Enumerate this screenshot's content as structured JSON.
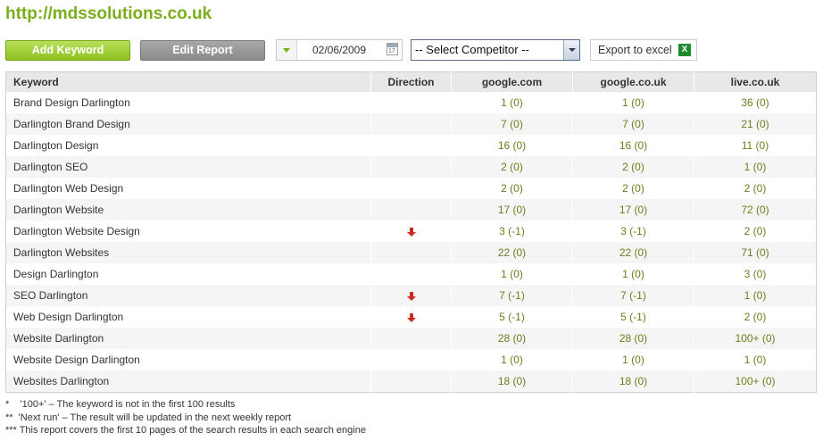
{
  "site": {
    "title": "http://mdssolutions.co.uk"
  },
  "toolbar": {
    "add_keyword_label": "Add Keyword",
    "edit_report_label": "Edit Report",
    "date_value": "02/06/2009",
    "competitor_selected": "-- Select Competitor --",
    "export_label": "Export to excel",
    "calendar_icon": "calendar-icon",
    "excel_icon": "excel-icon"
  },
  "colors": {
    "brand_green": "#7aae1a",
    "value_olive": "#6b7e1e",
    "arrow_red": "#cc2b20"
  },
  "table": {
    "headers": [
      "Keyword",
      "Direction",
      "google.com",
      "google.co.uk",
      "live.co.uk"
    ],
    "rows": [
      {
        "keyword": "Brand Design Darlington",
        "direction": "",
        "google_com": "1 (0)",
        "google_co_uk": "1 (0)",
        "live_co_uk": "36 (0)"
      },
      {
        "keyword": "Darlington Brand Design",
        "direction": "",
        "google_com": "7 (0)",
        "google_co_uk": "7 (0)",
        "live_co_uk": "21 (0)"
      },
      {
        "keyword": "Darlington Design",
        "direction": "",
        "google_com": "16 (0)",
        "google_co_uk": "16 (0)",
        "live_co_uk": "11 (0)"
      },
      {
        "keyword": "Darlington SEO",
        "direction": "",
        "google_com": "2 (0)",
        "google_co_uk": "2 (0)",
        "live_co_uk": "1 (0)"
      },
      {
        "keyword": "Darlington Web Design",
        "direction": "",
        "google_com": "2 (0)",
        "google_co_uk": "2 (0)",
        "live_co_uk": "2 (0)"
      },
      {
        "keyword": "Darlington Website",
        "direction": "",
        "google_com": "17 (0)",
        "google_co_uk": "17 (0)",
        "live_co_uk": "72 (0)"
      },
      {
        "keyword": "Darlington Website Design",
        "direction": "down",
        "google_com": "3 (-1)",
        "google_co_uk": "3 (-1)",
        "live_co_uk": "2 (0)"
      },
      {
        "keyword": "Darlington Websites",
        "direction": "",
        "google_com": "22 (0)",
        "google_co_uk": "22 (0)",
        "live_co_uk": "71 (0)"
      },
      {
        "keyword": "Design Darlington",
        "direction": "",
        "google_com": "1 (0)",
        "google_co_uk": "1 (0)",
        "live_co_uk": "3 (0)"
      },
      {
        "keyword": "SEO Darlington",
        "direction": "down",
        "google_com": "7 (-1)",
        "google_co_uk": "7 (-1)",
        "live_co_uk": "1 (0)"
      },
      {
        "keyword": "Web Design Darlington",
        "direction": "down",
        "google_com": "5 (-1)",
        "google_co_uk": "5 (-1)",
        "live_co_uk": "2 (0)"
      },
      {
        "keyword": "Website Darlington",
        "direction": "",
        "google_com": "28 (0)",
        "google_co_uk": "28 (0)",
        "live_co_uk": "100+ (0)"
      },
      {
        "keyword": "Website Design Darlington",
        "direction": "",
        "google_com": "1 (0)",
        "google_co_uk": "1 (0)",
        "live_co_uk": "1 (0)"
      },
      {
        "keyword": "Websites Darlington",
        "direction": "",
        "google_com": "18 (0)",
        "google_co_uk": "18 (0)",
        "live_co_uk": "100+ (0)"
      }
    ]
  },
  "notes": [
    "*    '100+' – The keyword is not in the first 100 results",
    "**  'Next run' – The result will be updated in the next weekly report",
    "*** This report covers the first 10 pages of the search results in each search engine"
  ]
}
